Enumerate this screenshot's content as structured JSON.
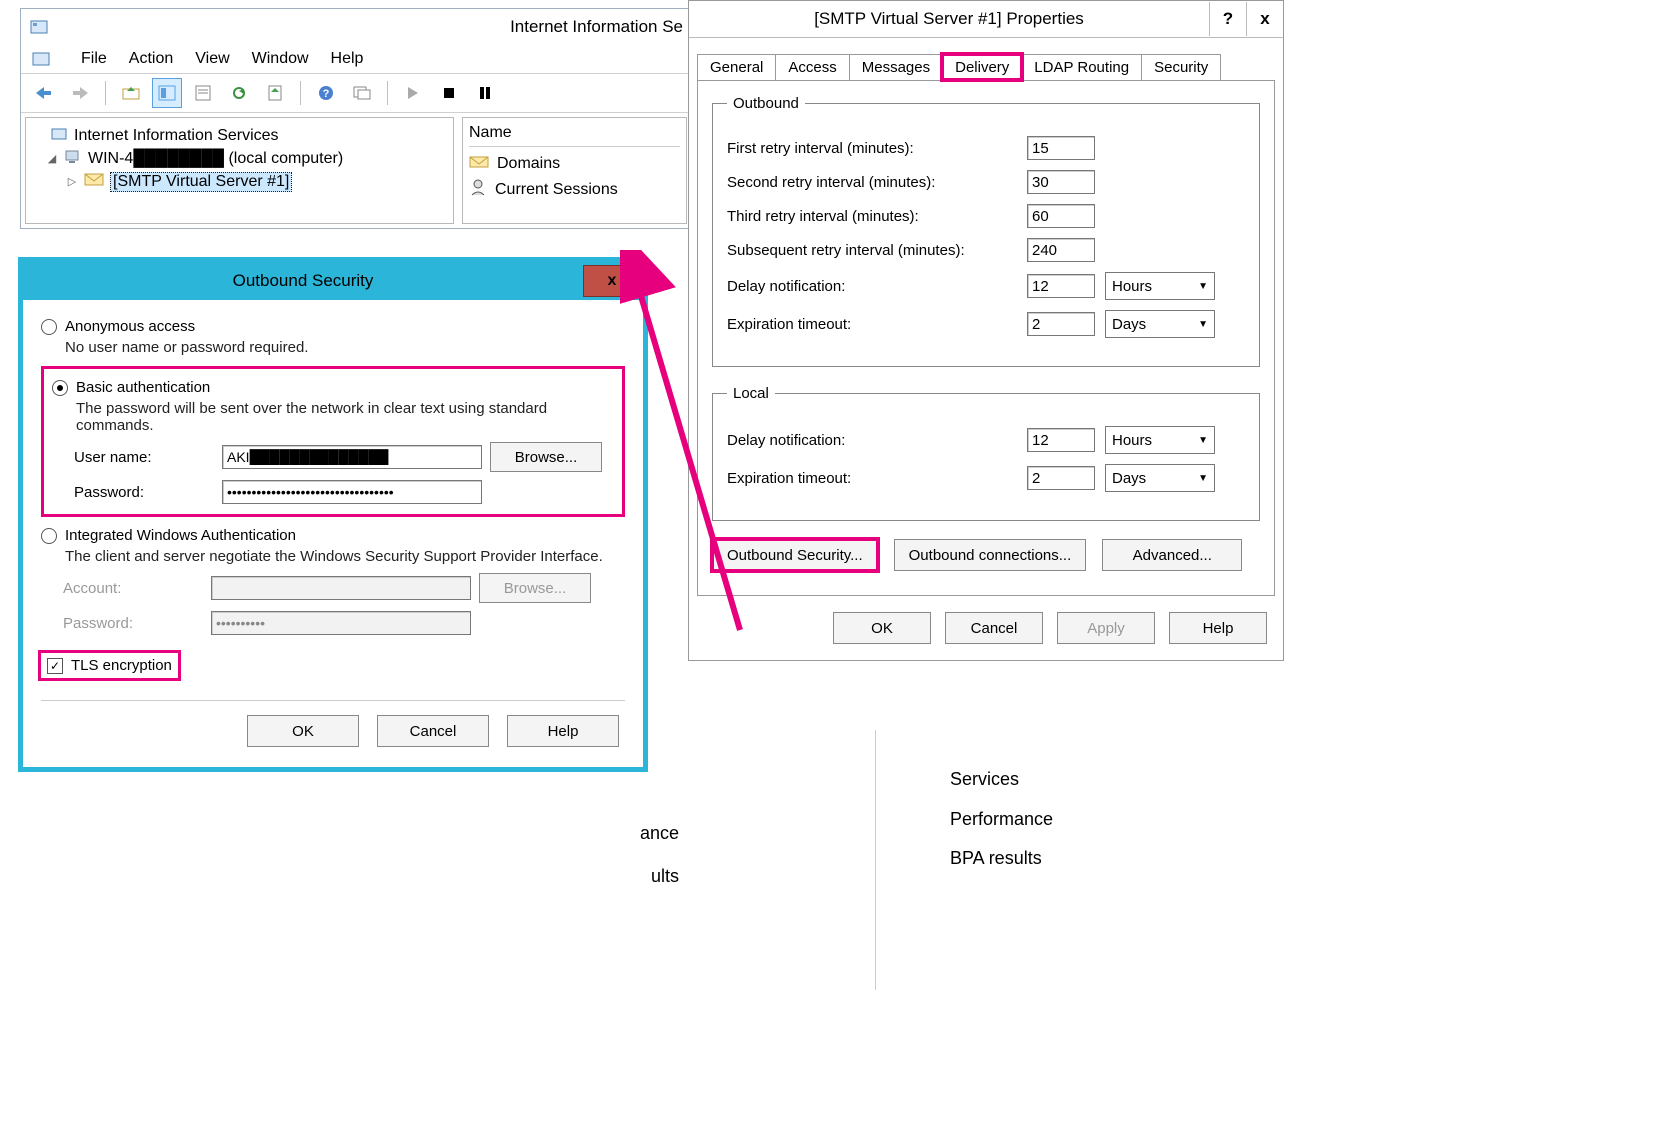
{
  "iis": {
    "title": "Internet Information Se",
    "menu": [
      "File",
      "Action",
      "View",
      "Window",
      "Help"
    ],
    "tree": {
      "root": "Internet Information Services",
      "computer": "WIN-4████████ (local computer)",
      "server": "[SMTP Virtual Server #1]"
    },
    "list": {
      "header": "Name",
      "items": [
        "Domains",
        "Current Sessions"
      ]
    }
  },
  "props": {
    "title": "[SMTP Virtual Server #1] Properties",
    "help_btn": "?",
    "close_btn": "x",
    "tabs": [
      "General",
      "Access",
      "Messages",
      "Delivery",
      "LDAP Routing",
      "Security"
    ],
    "outbound_legend": "Outbound",
    "local_legend": "Local",
    "fields": {
      "first_retry_lbl": "First retry interval (minutes):",
      "first_retry_val": "15",
      "second_retry_lbl": "Second retry interval (minutes):",
      "second_retry_val": "30",
      "third_retry_lbl": "Third retry interval (minutes):",
      "third_retry_val": "60",
      "subseq_retry_lbl": "Subsequent retry interval (minutes):",
      "subseq_retry_val": "240",
      "delay_notif_lbl": "Delay notification:",
      "delay_notif_val": "12",
      "delay_notif_unit": "Hours",
      "exp_timeout_lbl": "Expiration timeout:",
      "exp_timeout_val": "2",
      "exp_timeout_unit": "Days",
      "local_delay_val": "12",
      "local_delay_unit": "Hours",
      "local_exp_val": "2",
      "local_exp_unit": "Days"
    },
    "buttons": {
      "outbound_security": "Outbound Security...",
      "outbound_conn": "Outbound connections...",
      "advanced": "Advanced...",
      "ok": "OK",
      "cancel": "Cancel",
      "apply": "Apply",
      "help": "Help"
    }
  },
  "outsec": {
    "title": "Outbound Security",
    "close": "x",
    "anon_label": "Anonymous access",
    "anon_desc": "No user name or password required.",
    "basic_label": "Basic authentication",
    "basic_desc": "The password will be sent over the network in clear text using standard commands.",
    "user_lbl": "User name:",
    "user_val": "AKI██████████████",
    "pass_lbl": "Password:",
    "pass_val": "••••••••••••••••••••••••••••••••••",
    "browse": "Browse...",
    "iwa_label": "Integrated Windows Authentication",
    "iwa_desc": "The client and server negotiate the Windows Security Support Provider Interface.",
    "account_lbl": "Account:",
    "iwa_pass_lbl": "Password:",
    "iwa_pass_val": "••••••••••",
    "tls_label": "TLS encryption",
    "ok": "OK",
    "cancel": "Cancel",
    "help": "Help"
  },
  "behind": {
    "right": [
      "Services",
      "Performance",
      "BPA results"
    ],
    "left": [
      "ance",
      "ults"
    ]
  }
}
